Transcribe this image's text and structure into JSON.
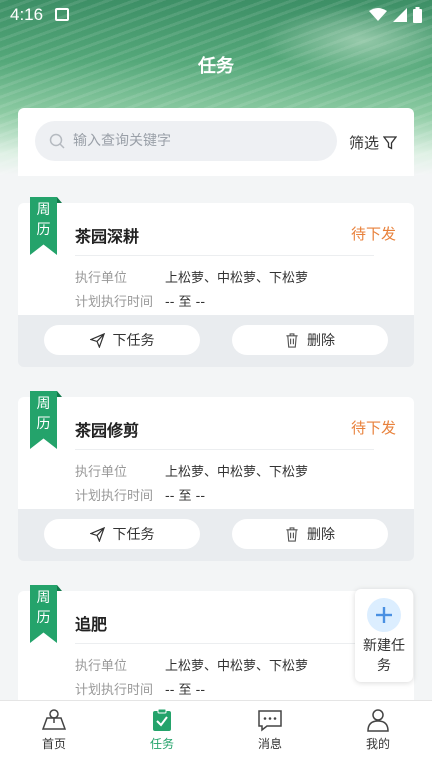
{
  "statusbar": {
    "time": "4:16"
  },
  "header": {
    "title": "任务"
  },
  "search": {
    "placeholder": "输入查询关键字",
    "filter_label": "筛选"
  },
  "tasks": [
    {
      "badge": "周历",
      "name": "茶园深耕",
      "status": "待下发",
      "unit_label": "执行单位",
      "unit_value": "上松萝、中松萝、下松萝",
      "time_label": "计划执行时间",
      "time_value": "--  至  --",
      "dispatch_label": "下任务",
      "delete_label": "删除"
    },
    {
      "badge": "周历",
      "name": "茶园修剪",
      "status": "待下发",
      "unit_label": "执行单位",
      "unit_value": "上松萝、中松萝、下松萝",
      "time_label": "计划执行时间",
      "time_value": "--  至  --",
      "dispatch_label": "下任务",
      "delete_label": "删除"
    },
    {
      "badge": "周历",
      "name": "追肥",
      "status": "待",
      "unit_label": "执行单位",
      "unit_value": "上松萝、中松萝、下松萝",
      "time_label": "计划执行时间",
      "time_value": "--  至  --"
    }
  ],
  "fab": {
    "label": "新建任务"
  },
  "tabbar": [
    {
      "label": "首页",
      "icon": "map-icon"
    },
    {
      "label": "任务",
      "icon": "clipboard-check-icon",
      "active": true
    },
    {
      "label": "消息",
      "icon": "message-icon"
    },
    {
      "label": "我的",
      "icon": "user-icon"
    }
  ],
  "colors": {
    "accent": "#24a36b",
    "status": "#e8813b"
  }
}
